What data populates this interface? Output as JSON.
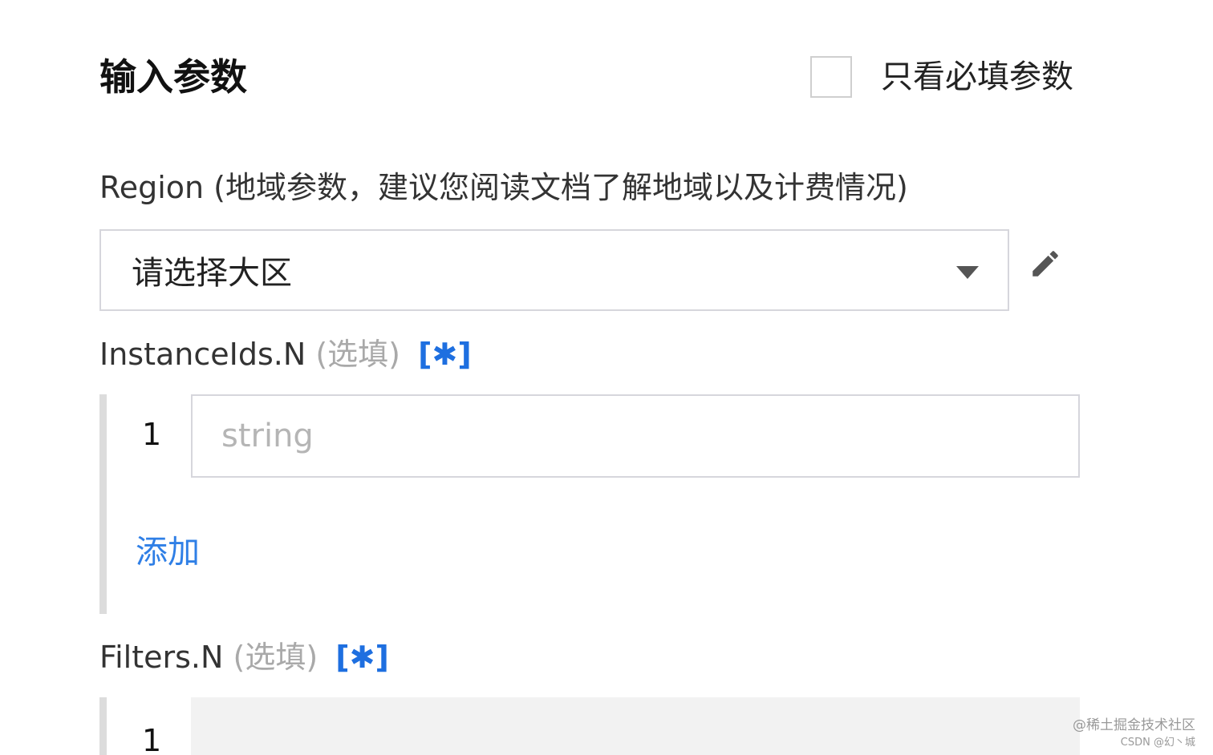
{
  "header": {
    "title": "输入参数",
    "required_only_label": "只看必填参数"
  },
  "region": {
    "label": "Region (地域参数，建议您阅读文档了解地域以及计费情况)",
    "select_value": "请选择大区"
  },
  "instance_ids": {
    "name": "InstanceIds.N",
    "optional_tag": "(选填)",
    "star_label": "[✱]",
    "rows": [
      {
        "index": "1",
        "placeholder": "string",
        "value": ""
      }
    ],
    "add_label": "添加"
  },
  "filters": {
    "name": "Filters.N",
    "optional_tag": "(选填)",
    "star_label": "[✱]",
    "rows": [
      {
        "index": "1"
      }
    ]
  },
  "watermark": {
    "line1": "@稀土掘金技术社区",
    "line2": "CSDN @幻丶城"
  },
  "colors": {
    "link": "#2f7fe6",
    "star": "#1e6fe0",
    "optional_text": "#a9a9a9",
    "border": "#d6d6dc"
  },
  "icons": {
    "edit": "pencil-icon",
    "dropdown": "caret-down-icon"
  }
}
